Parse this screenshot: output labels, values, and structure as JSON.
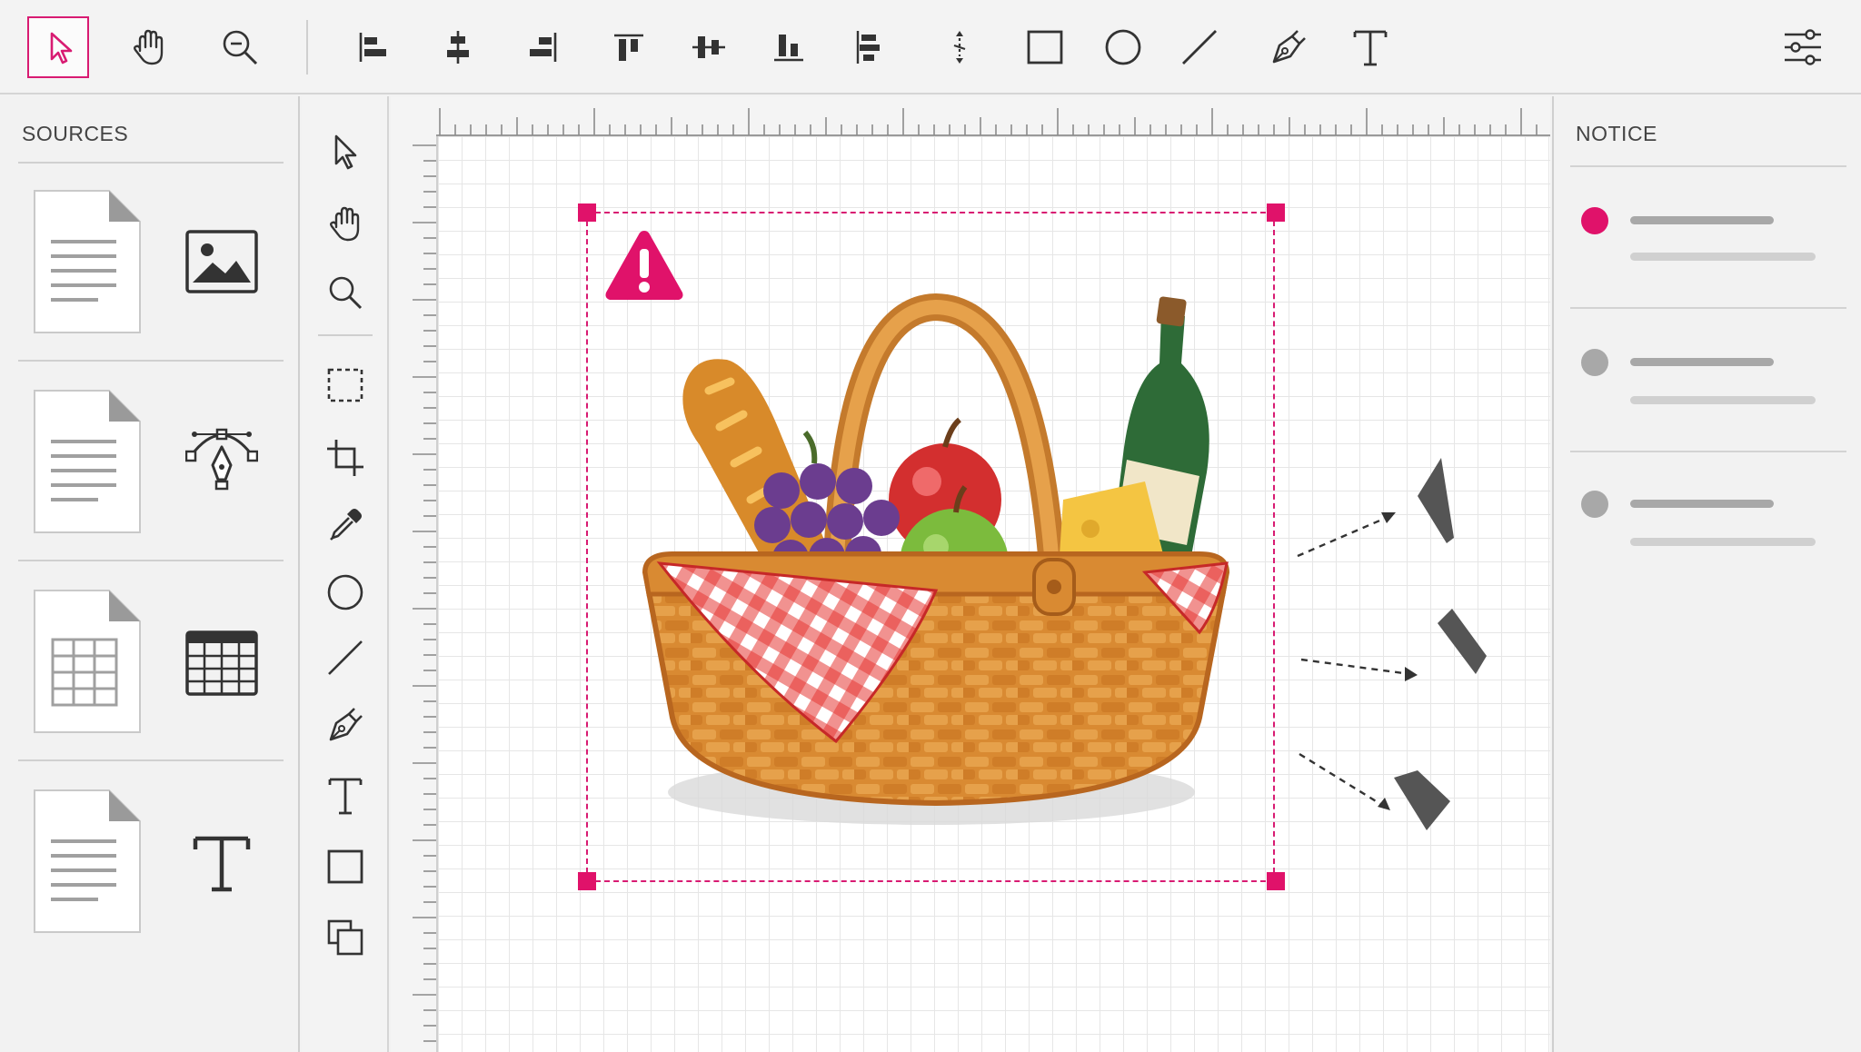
{
  "colors": {
    "accent": "#d81b72",
    "icon": "#333333",
    "notice_active": "#e0126a",
    "notice_inactive": "#a8a8a8"
  },
  "toolbar": {
    "tools": [
      "select-arrow-icon",
      "hand-icon",
      "zoom-out-icon",
      "align-left-icon",
      "align-center-icon",
      "align-right-icon",
      "align-top-icon",
      "align-middle-icon",
      "align-bottom-icon",
      "distribute-horizontal-icon",
      "distribute-vertical-icon",
      "rectangle-icon",
      "ellipse-icon",
      "line-icon",
      "pen-icon",
      "text-icon",
      "settings-sliders-icon"
    ],
    "active_tool": "select-arrow-icon"
  },
  "sources": {
    "title": "SOURCES",
    "items": [
      {
        "doc": "document-icon",
        "icon": "image-icon"
      },
      {
        "doc": "document-icon",
        "icon": "vector-pen-icon"
      },
      {
        "doc": "spreadsheet-document-icon",
        "icon": "table-icon"
      },
      {
        "doc": "document-icon",
        "icon": "text-type-icon"
      }
    ]
  },
  "side_tools": [
    "select-arrow-icon",
    "hand-icon",
    "zoom-icon",
    "marquee-select-icon",
    "crop-icon",
    "eyedropper-icon",
    "ellipse-icon",
    "line-icon",
    "pen-icon",
    "text-icon",
    "rectangle-icon",
    "duplicate-icon"
  ],
  "canvas": {
    "artwork": "picnic-basket-illustration",
    "warning": "warning-triangle-icon",
    "fragments": 3
  },
  "notice": {
    "title": "NOTICE",
    "items": [
      {
        "status": "active"
      },
      {
        "status": "inactive"
      },
      {
        "status": "inactive"
      }
    ]
  }
}
